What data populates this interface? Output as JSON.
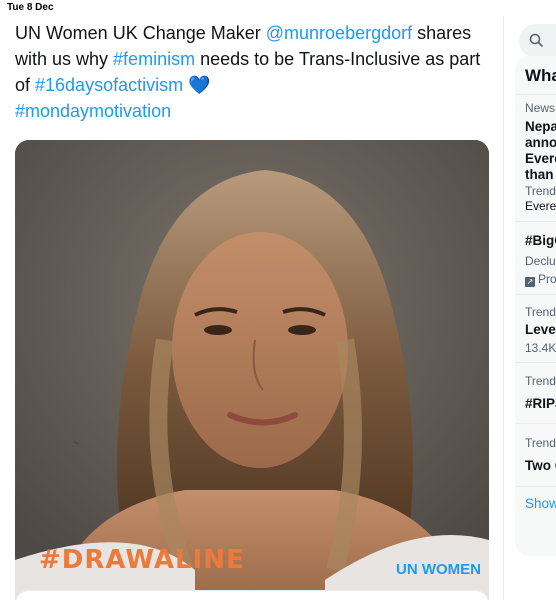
{
  "status_bar": {
    "date": "Tue 8 Dec"
  },
  "tweet": {
    "text_1": "UN Women UK Change Maker ",
    "mention": "@munroebergdorf",
    "text_2": " shares with us why ",
    "hashtag_feminism": "#feminism",
    "text_3": " needs to be Trans-Inclusive as part of ",
    "hashtag_16days": "#16daysofactivism",
    "heart": "💙",
    "hashtag_monday": "#mondaymotivation",
    "media": {
      "overlay_hashtag": "#DRAWALINE",
      "brand_logo": "UN WOMEN"
    }
  },
  "sidebar": {
    "title": "Wha",
    "trends": [
      {
        "meta": "News",
        "title_lines": [
          "Nepa",
          "anno",
          "Evere",
          "than "
        ],
        "sub": "Trendi",
        "small": "Everes"
      },
      {
        "title": "#BigC",
        "sub": "Declu",
        "promo": "Pro"
      },
      {
        "meta": "Trend",
        "title": "Level",
        "sub": "13.4K"
      },
      {
        "meta": "Trend",
        "title": "#RIPJ"
      },
      {
        "meta": "Trend",
        "title": "Two C"
      }
    ],
    "show_more": "Show"
  },
  "colors": {
    "link": "#1d9bf0",
    "text": "#0f1419",
    "muted": "#536471",
    "panel": "#f7f9f9"
  }
}
